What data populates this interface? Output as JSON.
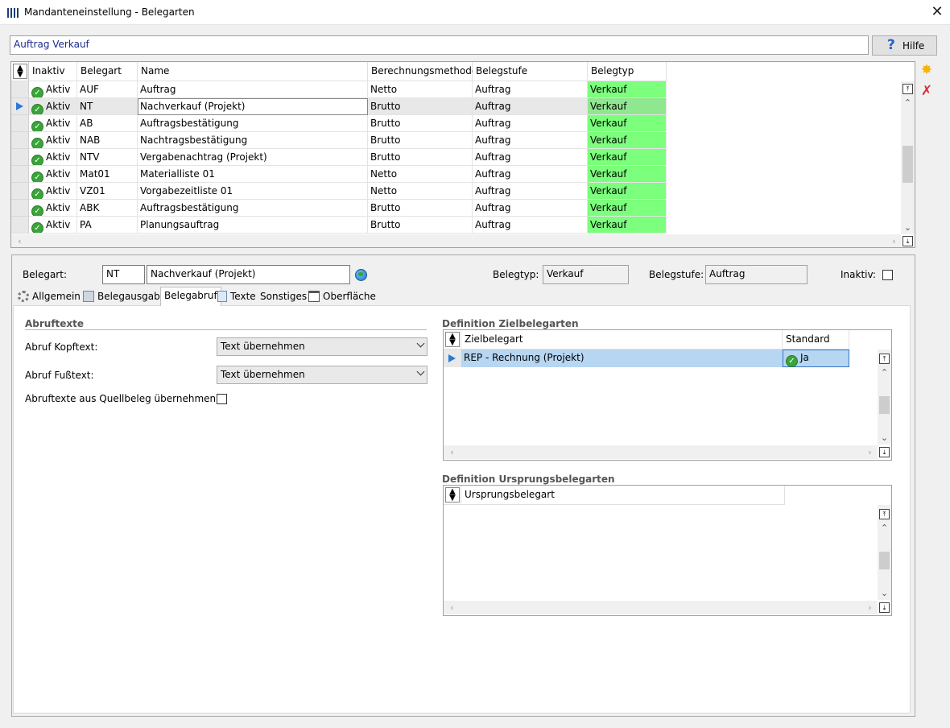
{
  "window": {
    "title": "Mandanteneinstellung - Belegarten",
    "close_glyph": "✕"
  },
  "selector": {
    "value": "Auftrag Verkauf"
  },
  "help_button": {
    "label": "Hilfe",
    "glyph": "?"
  },
  "grid": {
    "columns": [
      "Inaktiv",
      "Belegart",
      "Name",
      "Berechnungsmethode",
      "Belegstufe",
      "Belegtyp"
    ],
    "rows": [
      {
        "inaktiv": "Aktiv",
        "belegart": "AUF",
        "name": "Auftrag",
        "methode": "Netto",
        "stufe": "Auftrag",
        "typ": "Verkauf",
        "selected": false
      },
      {
        "inaktiv": "Aktiv",
        "belegart": "NT",
        "name": "Nachverkauf (Projekt)",
        "methode": "Brutto",
        "stufe": "Auftrag",
        "typ": "Verkauf",
        "selected": true
      },
      {
        "inaktiv": "Aktiv",
        "belegart": "AB",
        "name": "Auftragsbestätigung",
        "methode": "Brutto",
        "stufe": "Auftrag",
        "typ": "Verkauf",
        "selected": false
      },
      {
        "inaktiv": "Aktiv",
        "belegart": "NAB",
        "name": "Nachtragsbestätigung",
        "methode": "Brutto",
        "stufe": "Auftrag",
        "typ": "Verkauf",
        "selected": false
      },
      {
        "inaktiv": "Aktiv",
        "belegart": "NTV",
        "name": "Vergabenachtrag (Projekt)",
        "methode": "Brutto",
        "stufe": "Auftrag",
        "typ": "Verkauf",
        "selected": false
      },
      {
        "inaktiv": "Aktiv",
        "belegart": "Mat01",
        "name": "Materialliste 01",
        "methode": "Netto",
        "stufe": "Auftrag",
        "typ": "Verkauf",
        "selected": false
      },
      {
        "inaktiv": "Aktiv",
        "belegart": "VZ01",
        "name": "Vorgabezeitliste 01",
        "methode": "Netto",
        "stufe": "Auftrag",
        "typ": "Verkauf",
        "selected": false
      },
      {
        "inaktiv": "Aktiv",
        "belegart": "ABK",
        "name": "Auftragsbestätigung",
        "methode": "Brutto",
        "stufe": "Auftrag",
        "typ": "Verkauf",
        "selected": false
      },
      {
        "inaktiv": "Aktiv",
        "belegart": "PA",
        "name": "Planungsauftrag",
        "methode": "Brutto",
        "stufe": "Auftrag",
        "typ": "Verkauf",
        "selected": false
      }
    ],
    "belegtyp_color": "#7cff7c"
  },
  "detail": {
    "belegart_label": "Belegart:",
    "belegart_code": "NT",
    "belegart_name": "Nachverkauf (Projekt)",
    "belegtyp_label": "Belegtyp:",
    "belegtyp_value": "Verkauf",
    "belegstufe_label": "Belegstufe:",
    "belegstufe_value": "Auftrag",
    "inaktiv_label": "Inaktiv:"
  },
  "tabs": [
    {
      "label": "Allgemein",
      "icon": "gear-icon"
    },
    {
      "label": "Belegausgabe",
      "icon": "printer-icon"
    },
    {
      "label": "Belegabruf",
      "icon": "",
      "active": true
    },
    {
      "label": "Texte",
      "icon": "document-icon"
    },
    {
      "label": "Sonstiges",
      "icon": ""
    },
    {
      "label": "Oberfläche",
      "icon": "window-icon"
    }
  ],
  "abruf": {
    "section": "Abruftexte",
    "kopf_label": "Abruf Kopftext:",
    "kopf_value": "Text übernehmen",
    "fuss_label": "Abruf Fußtext:",
    "fuss_value": "Text übernehmen",
    "quell_label": "Abruftexte aus Quellbeleg übernehmen:"
  },
  "ziel": {
    "section": "Definition Zielbelegarten",
    "col_ziel": "Zielbelegart",
    "col_standard": "Standard",
    "rows": [
      {
        "ziel": "REP - Rechnung (Projekt)",
        "standard": "Ja"
      }
    ]
  },
  "ursprung": {
    "section": "Definition Ursprungsbelegarten",
    "col_ursprung": "Ursprungsbelegart"
  }
}
